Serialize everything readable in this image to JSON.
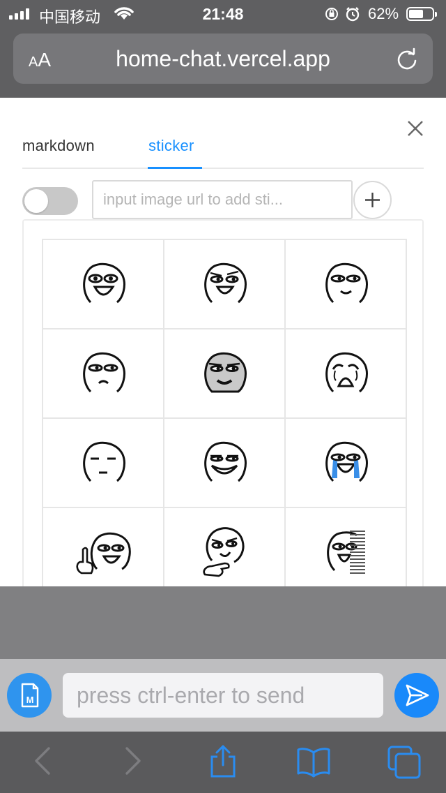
{
  "status_bar": {
    "carrier": "中国移动",
    "time": "21:48",
    "battery": "62%",
    "battery_level": 0.62
  },
  "browser": {
    "aa_small": "A",
    "aa_large": "A",
    "url": "home-chat.vercel.app"
  },
  "panel": {
    "tabs": [
      {
        "label": "markdown",
        "active": false
      },
      {
        "label": "sticker",
        "active": true
      }
    ],
    "toggle_on": false,
    "sticker_url_placeholder": "input image url to add sti...",
    "stickers": [
      {
        "icon": "grin-face-icon"
      },
      {
        "icon": "smug-grin-face-icon"
      },
      {
        "icon": "smile-face-icon"
      },
      {
        "icon": "frown-face-icon"
      },
      {
        "icon": "gray-grin-face-icon"
      },
      {
        "icon": "crying-shocked-face-icon"
      },
      {
        "icon": "blank-stare-face-icon"
      },
      {
        "icon": "wide-grin-face-icon"
      },
      {
        "icon": "tears-of-joy-face-icon"
      },
      {
        "icon": "middle-finger-face-icon"
      },
      {
        "icon": "thinking-chin-face-icon"
      },
      {
        "icon": "half-hidden-face-icon"
      }
    ]
  },
  "chat": {
    "placeholder": "press ctrl-enter to send",
    "md_label": "M"
  },
  "colors": {
    "accent": "#1890ff",
    "send_button": "#1989fa",
    "markdown_button": "#2f94ee",
    "tear_blue": "#3a8fe8"
  }
}
